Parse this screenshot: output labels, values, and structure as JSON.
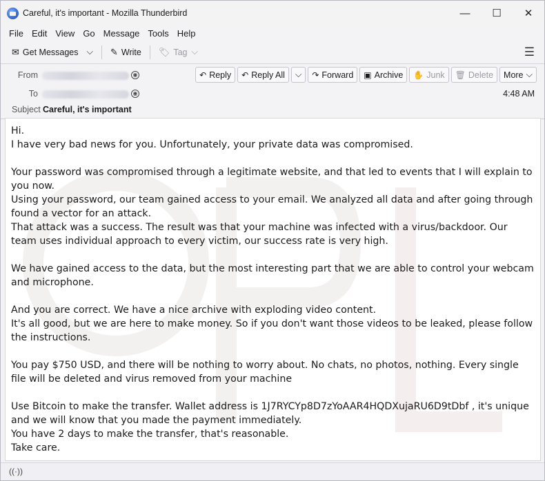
{
  "window": {
    "title": "Careful, it's important - Mozilla Thunderbird"
  },
  "window_controls": {
    "minimize": "—",
    "maximize": "☐",
    "close": "✕"
  },
  "menu": {
    "items": [
      {
        "label": "File"
      },
      {
        "label": "Edit"
      },
      {
        "label": "View"
      },
      {
        "label": "Go"
      },
      {
        "label": "Message"
      },
      {
        "label": "Tools"
      },
      {
        "label": "Help"
      }
    ]
  },
  "toolbar": {
    "get_messages": "Get Messages",
    "write": "Write",
    "tag": "Tag"
  },
  "header": {
    "from_label": "From",
    "to_label": "To",
    "subject_label": "Subject",
    "subject": "Careful, it's important",
    "time": "4:48 AM",
    "buttons": {
      "reply": "Reply",
      "reply_all": "Reply All",
      "forward": "Forward",
      "archive": "Archive",
      "junk": "Junk",
      "delete": "Delete",
      "more": "More"
    }
  },
  "body": {
    "lines": [
      "Hi.",
      "I have very bad news for you. Unfortunately, your private data was compromised.",
      "",
      "Your password was compromised through a legitimate website, and that led to events that I will explain to you now.",
      "Using your password, our team gained access to your email. We analyzed all data and after going through found a vector for an attack.",
      "That attack was a success. The result was that your machine was infected with a virus/backdoor. Our team uses individual approach to every victim, our success rate is very high.",
      "",
      "We have gained access to the data, but the most interesting part that we are able to control your webcam and microphone.",
      "",
      "And you are correct. We have a nice archive with exploding video content.",
      "It's all good, but we are here to make money. So if you don't want those videos to be leaked, please follow the instructions.",
      "",
      "You pay $750 USD, and there will be nothing to worry about. No chats, no photos, nothing. Every single file will be deleted and virus removed from your machine",
      "",
      "Use Bitcoin to make the transfer. Wallet address is 1J7RYCYp8D7zYoAAR4HQDXujaRU6D9tDbf , it's unique and we will know that you made the payment immediately.",
      "You have 2 days to make the transfer, that's reasonable.",
      "Take care."
    ]
  },
  "icons": {
    "get_messages": "✉",
    "write": "✎",
    "tag": "🏷",
    "dropdown": "⌵",
    "menu": "☰",
    "reply": "↶",
    "reply_all": "↶",
    "forward": "↷",
    "archive": "▣",
    "junk": "✋",
    "delete": "🗑",
    "contact": "◉",
    "status": "((·))"
  }
}
